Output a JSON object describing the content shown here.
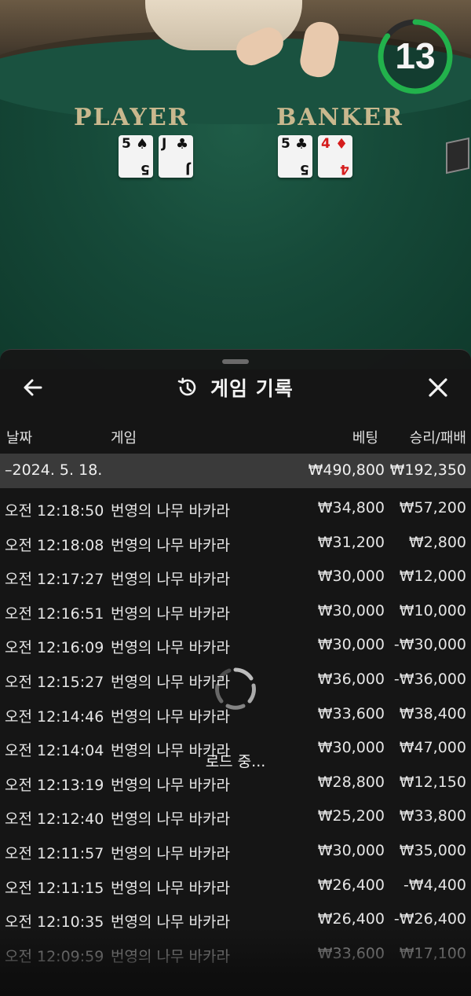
{
  "table": {
    "player_label": "PLAYER",
    "banker_label": "BANKER",
    "countdown": "13",
    "countdown_fraction": 0.85,
    "player_cards": [
      {
        "rank": "5",
        "suit": "♠",
        "color": "#111111"
      },
      {
        "rank": "J",
        "suit": "♣",
        "color": "#111111"
      }
    ],
    "banker_cards": [
      {
        "rank": "5",
        "suit": "♣",
        "color": "#111111"
      },
      {
        "rank": "4",
        "suit": "♦",
        "color": "#d51c1c"
      }
    ]
  },
  "sheet": {
    "title": "게임 기록",
    "back_icon": "arrow-left-icon",
    "close_icon": "close-icon",
    "history_icon": "history-clock-icon",
    "columns": {
      "date": "날짜",
      "game": "게임",
      "bet": "베팅",
      "result": "승리/패배"
    },
    "summary": {
      "date": "–2024. 5. 18.",
      "bet": "₩490,800",
      "result": "₩192,350"
    },
    "rows": [
      {
        "time": "오전 12:18:50",
        "game": "번영의 나무 바카라",
        "bet": "₩34,800",
        "result": "₩57,200"
      },
      {
        "time": "오전 12:18:08",
        "game": "번영의 나무 바카라",
        "bet": "₩31,200",
        "result": "₩2,800"
      },
      {
        "time": "오전 12:17:27",
        "game": "번영의 나무 바카라",
        "bet": "₩30,000",
        "result": "₩12,000"
      },
      {
        "time": "오전 12:16:51",
        "game": "번영의 나무 바카라",
        "bet": "₩30,000",
        "result": "₩10,000"
      },
      {
        "time": "오전 12:16:09",
        "game": "번영의 나무 바카라",
        "bet": "₩30,000",
        "result": "-₩30,000"
      },
      {
        "time": "오전 12:15:27",
        "game": "번영의 나무 바카라",
        "bet": "₩36,000",
        "result": "-₩36,000"
      },
      {
        "time": "오전 12:14:46",
        "game": "번영의 나무 바카라",
        "bet": "₩33,600",
        "result": "₩38,400"
      },
      {
        "time": "오전 12:14:04",
        "game": "번영의 나무 바카라",
        "bet": "₩30,000",
        "result": "₩47,000"
      },
      {
        "time": "오전 12:13:19",
        "game": "번영의 나무 바카라",
        "bet": "₩28,800",
        "result": "₩12,150"
      },
      {
        "time": "오전 12:12:40",
        "game": "번영의 나무 바카라",
        "bet": "₩25,200",
        "result": "₩33,800"
      },
      {
        "time": "오전 12:11:57",
        "game": "번영의 나무 바카라",
        "bet": "₩30,000",
        "result": "₩35,000"
      },
      {
        "time": "오전 12:11:15",
        "game": "번영의 나무 바카라",
        "bet": "₩26,400",
        "result": "-₩4,400"
      },
      {
        "time": "오전 12:10:35",
        "game": "번영의 나무 바카라",
        "bet": "₩26,400",
        "result": "-₩26,400"
      },
      {
        "time": "오전 12:09:59",
        "game": "번영의 나무 바카라",
        "bet": "₩33,600",
        "result": "₩17,100"
      }
    ],
    "loading_label": "로드 중..."
  },
  "colors": {
    "timer_ring": "#22b24c",
    "felt": "#164a39",
    "sheet_bg": "#161616",
    "summary_bg": "#3a3a3a",
    "label_gold": "#c9b88e"
  }
}
